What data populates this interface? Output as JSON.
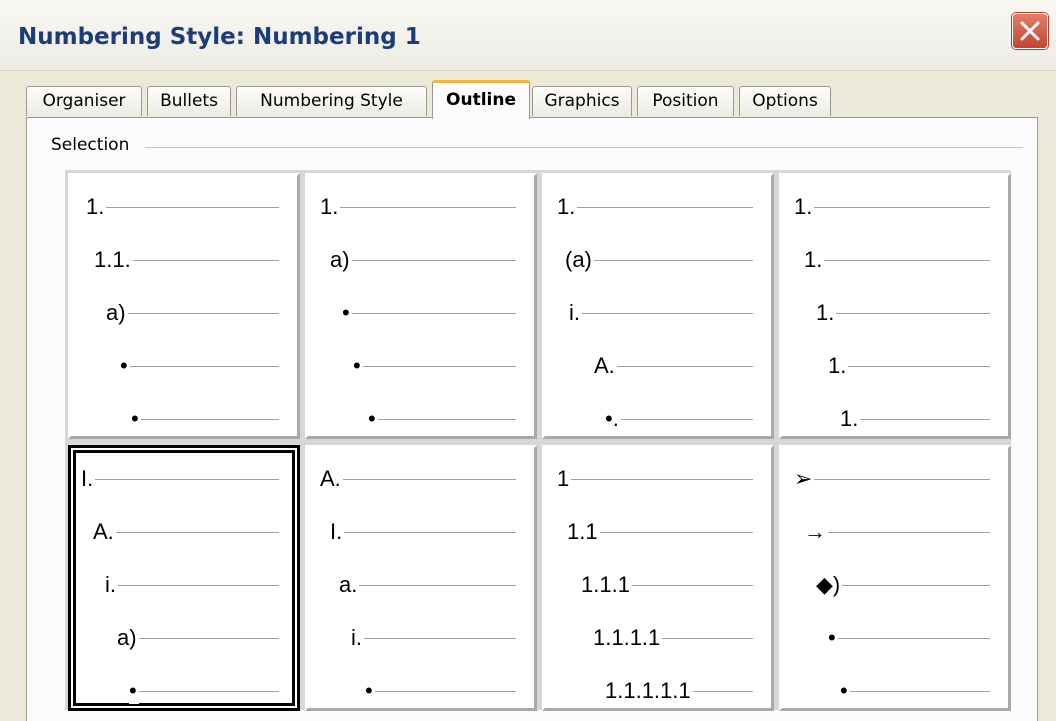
{
  "window": {
    "title": "Numbering Style: Numbering 1",
    "close_icon": "close-icon"
  },
  "tabs": [
    {
      "label": "Organiser",
      "active": false
    },
    {
      "label": "Bullets",
      "active": false
    },
    {
      "label": "Numbering Style",
      "active": false
    },
    {
      "label": "Outline",
      "active": true
    },
    {
      "label": "Graphics",
      "active": false
    },
    {
      "label": "Position",
      "active": false
    },
    {
      "label": "Options",
      "active": false
    }
  ],
  "selection": {
    "label": "Selection",
    "selected_index": 4,
    "options": [
      {
        "levels": [
          "1.",
          "1.1.",
          "a)",
          "•",
          "•"
        ]
      },
      {
        "levels": [
          "1.",
          "a)",
          "•",
          "•",
          "•"
        ]
      },
      {
        "levels": [
          "1.",
          "(a)",
          "i.",
          "A.",
          "•."
        ]
      },
      {
        "levels": [
          "1.",
          "1.",
          "1.",
          "1.",
          "1."
        ]
      },
      {
        "levels": [
          "I.",
          "A.",
          "i.",
          "a)",
          "•"
        ]
      },
      {
        "levels": [
          "A.",
          "I.",
          "a.",
          "i.",
          "•"
        ]
      },
      {
        "levels": [
          "1",
          "1.1",
          "1.1.1",
          "1.1.1.1",
          "1.1.1.1.1"
        ]
      },
      {
        "levels": [
          "➢",
          "→",
          "◆)",
          "•",
          "•"
        ]
      }
    ]
  }
}
